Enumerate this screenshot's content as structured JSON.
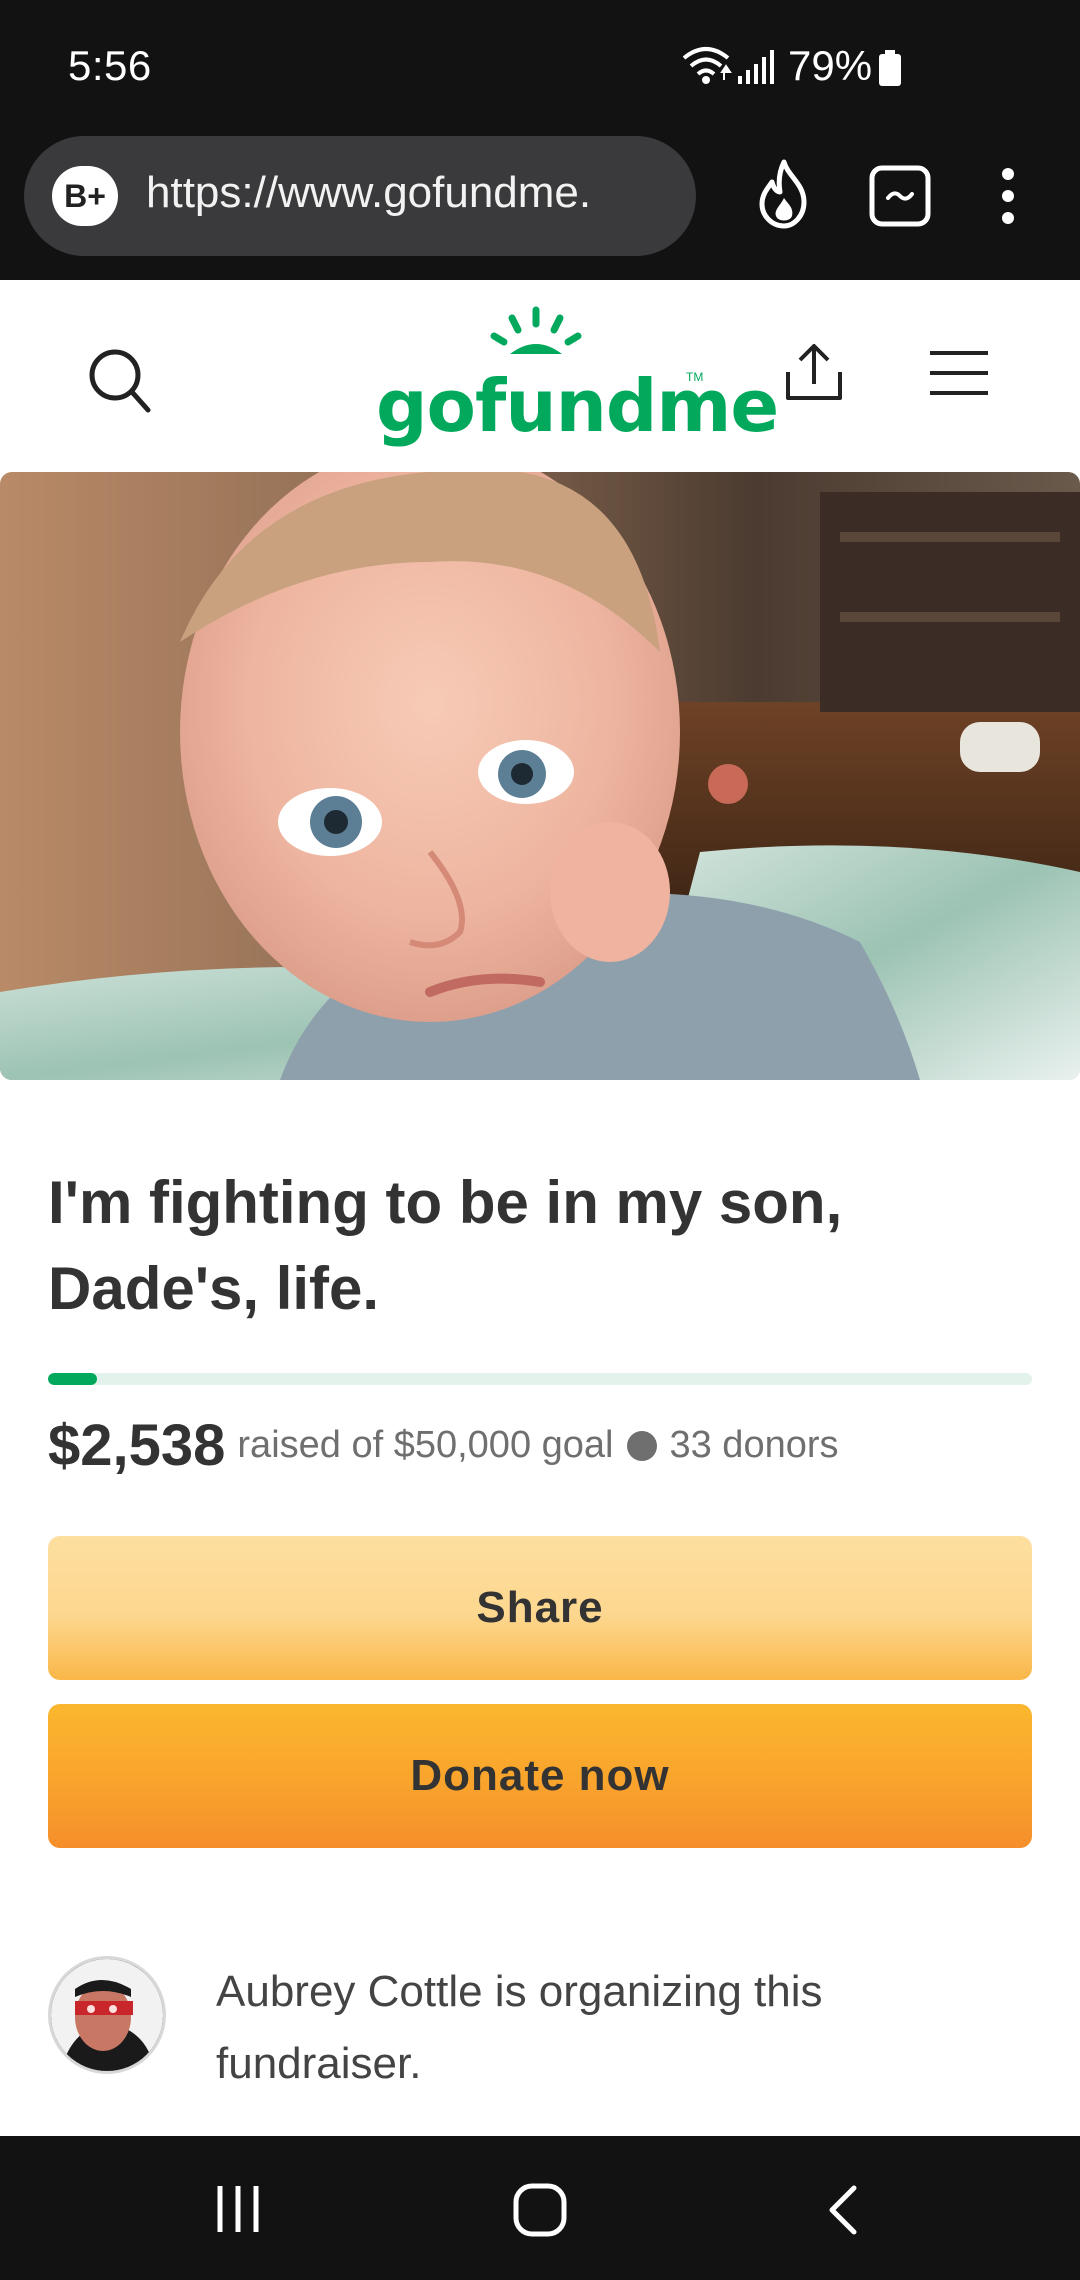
{
  "status_bar": {
    "time": "5:56",
    "battery": "79%"
  },
  "browser": {
    "badge": "B+",
    "url": "https://www.gofundme.",
    "icons": [
      "fire-icon",
      "tab-switcher-icon",
      "more-vert-icon"
    ]
  },
  "site_header": {
    "logo_text": "gofundme",
    "logo_tm": "TM",
    "brand_color": "#02a95c",
    "icons": [
      "search-icon",
      "share-icon",
      "menu-icon"
    ]
  },
  "campaign": {
    "title": "I'm fighting to be in my son, Dade's, life.",
    "raised": "$2,538",
    "raised_label": "raised of $50,000 goal",
    "donors": "33 donors",
    "progress_fraction": 0.05
  },
  "buttons": {
    "share": "Share",
    "donate": "Donate now"
  },
  "organizer": {
    "text": "Aubrey Cottle is organizing this fundraiser."
  },
  "nav_bar": {
    "icons": [
      "recent-apps-icon",
      "home-icon",
      "back-icon"
    ]
  }
}
